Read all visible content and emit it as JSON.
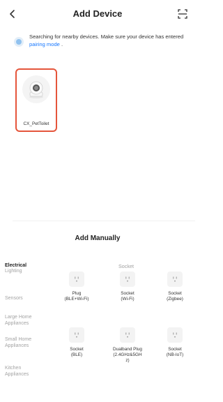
{
  "header": {
    "title": "Add Device"
  },
  "notice": {
    "text": "Searching for nearby devices. Make sure your device has entered",
    "link": "pairing mode",
    "suffix": "."
  },
  "found_devices": [
    {
      "name": "CX_PetToilet"
    }
  ],
  "manual": {
    "title": "Add Manually"
  },
  "sidebar": {
    "items": [
      {
        "label": "Electrical",
        "active": true
      },
      {
        "label": "Lighting",
        "active": false
      },
      {
        "label": "Sensors",
        "active": false
      },
      {
        "label": "Large Home Appliances",
        "active": false
      },
      {
        "label": "Small Home Appliances",
        "active": false
      },
      {
        "label": "Kitchen Appliances",
        "active": false
      }
    ]
  },
  "category": {
    "title": "Socket",
    "products": [
      {
        "label": "Plug\n(BLE+Wi-Fi)",
        "icon": "socket-icon"
      },
      {
        "label": "Socket\n(Wi-Fi)",
        "icon": "socket-icon"
      },
      {
        "label": "Socket\n(Zigbee)",
        "icon": "socket-icon"
      },
      {
        "label": "Socket\n(BLE)",
        "icon": "socket-icon"
      },
      {
        "label": "Dualband Plug\n(2.4GHz&5GH\nz)",
        "icon": "socket-icon"
      },
      {
        "label": "Socket\n(NB-IoT)",
        "icon": "socket-icon"
      }
    ]
  },
  "colors": {
    "accent": "#1677ff",
    "highlight_border": "#e5553b"
  }
}
